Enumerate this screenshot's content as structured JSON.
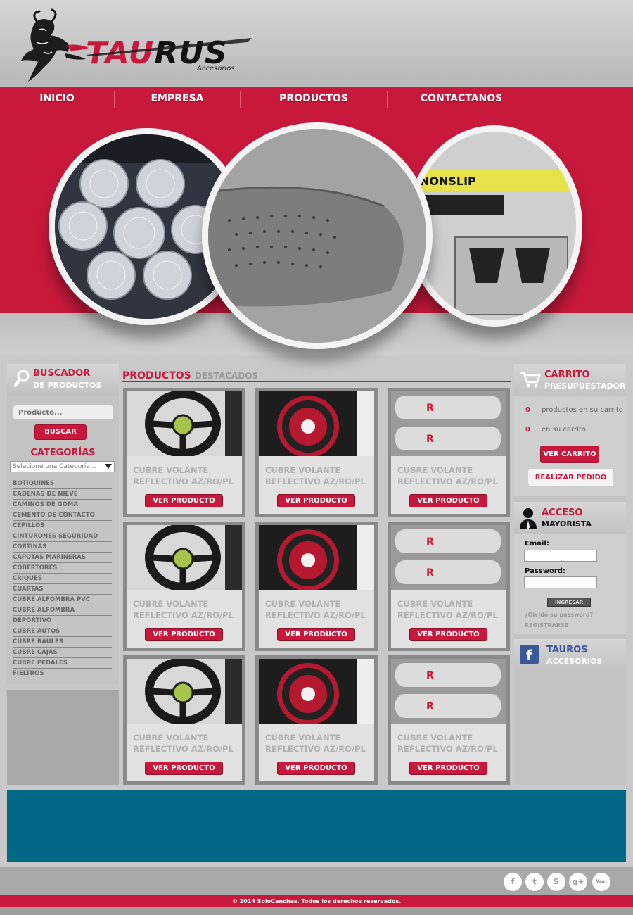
{
  "brand": {
    "logo_text_red": "TAU",
    "logo_text_black": "RUS",
    "logo_sub": "Accesorios"
  },
  "nav": {
    "items": [
      {
        "label": "INICIO"
      },
      {
        "label": "EMPRESA"
      },
      {
        "label": "PRODUCTOS"
      },
      {
        "label": "CONTACTANOS"
      }
    ]
  },
  "search": {
    "title_1": "BUSCADOR",
    "title_2": "DE PRODUCTOS",
    "placeholder": "Producto...",
    "button": "BUSCAR"
  },
  "categories": {
    "title": "CATEGORÍAS",
    "select_value": "Selecione una Categoría...",
    "items": [
      "BOTIQUINES",
      "CADENAS DE NIEVE",
      "CAMINOS DE GOMA",
      "CEMENTO DE CONTACTO",
      "CEPILLOS",
      "CINTURONES SEGURIDAD",
      "CORTINAS",
      "CAPOTAS MARINERAS",
      "COBERTORES",
      "CRIQUES",
      "CUARTAS",
      "CUBRE ALFOMBRA PVC",
      "CUBRE ALFOMBRA",
      "DEPORTIVO",
      "CUBRE AUTOS",
      "CUBRE BAULES",
      "CUBRE CAJAS",
      "CUBRE PEDALES",
      "FIELTROS"
    ]
  },
  "products": {
    "heading_main": "PRODUCTOS",
    "heading_sub": "DESTACADOS",
    "items": [
      {
        "name": "CUBRE VOLANTE REFLECTIVO AZ/RO/PL",
        "button": "VER PRODUCTO",
        "image": "steering-wheel-cover-black"
      },
      {
        "name": "CUBRE VOLANTE REFLECTIVO AZ/RO/PL",
        "button": "VER PRODUCTO",
        "image": "steering-wheel-cover-package"
      },
      {
        "name": "CUBRE VOLANTE REFLECTIVO AZ/RO/PL",
        "button": "VER PRODUCTO",
        "image": "seat-belt-pads-silver"
      },
      {
        "name": "CUBRE VOLANTE REFLECTIVO AZ/RO/PL",
        "button": "VER PRODUCTO",
        "image": "steering-wheel-cover-black"
      },
      {
        "name": "CUBRE VOLANTE REFLECTIVO AZ/RO/PL",
        "button": "VER PRODUCTO",
        "image": "steering-wheel-cover-package"
      },
      {
        "name": "CUBRE VOLANTE REFLECTIVO AZ/RO/PL",
        "button": "VER PRODUCTO",
        "image": "seat-belt-pads-silver"
      },
      {
        "name": "CUBRE VOLANTE REFLECTIVO AZ/RO/PL",
        "button": "VER PRODUCTO",
        "image": "steering-wheel-cover-black"
      },
      {
        "name": "CUBRE VOLANTE REFLECTIVO AZ/RO/PL",
        "button": "VER PRODUCTO",
        "image": "steering-wheel-cover-package"
      },
      {
        "name": "CUBRE VOLANTE REFLECTIVO AZ/RO/PL",
        "button": "VER PRODUCTO",
        "image": "seat-belt-pads-silver"
      }
    ]
  },
  "cart": {
    "title_1": "CARRITO",
    "title_2": "PRESUPUESTADOR",
    "count_1": "0",
    "text_1": "productos en su carrito",
    "count_2": "0",
    "text_2": "en su carrito",
    "view_button": "VER CARRITO",
    "order_button": "REALIZAR PEDIDO"
  },
  "login": {
    "title_1": "ACCESO",
    "title_2": "MAYORISTA",
    "email_label": "Email:",
    "password_label": "Password:",
    "submit": "INGRESAR",
    "forgot": "¿Olvidó su password?",
    "register": "REGISTRARSE"
  },
  "facebook": {
    "title_1": "TAUROS",
    "title_2": "ACCESORIOS"
  },
  "footer": {
    "social": [
      "f",
      "t",
      "S",
      "g+",
      "You"
    ],
    "copyright": "© 2014 SoloCanchas. Todos los derechos reservados."
  },
  "colors": {
    "accent": "#c8193c",
    "blue_block": "#006786"
  }
}
